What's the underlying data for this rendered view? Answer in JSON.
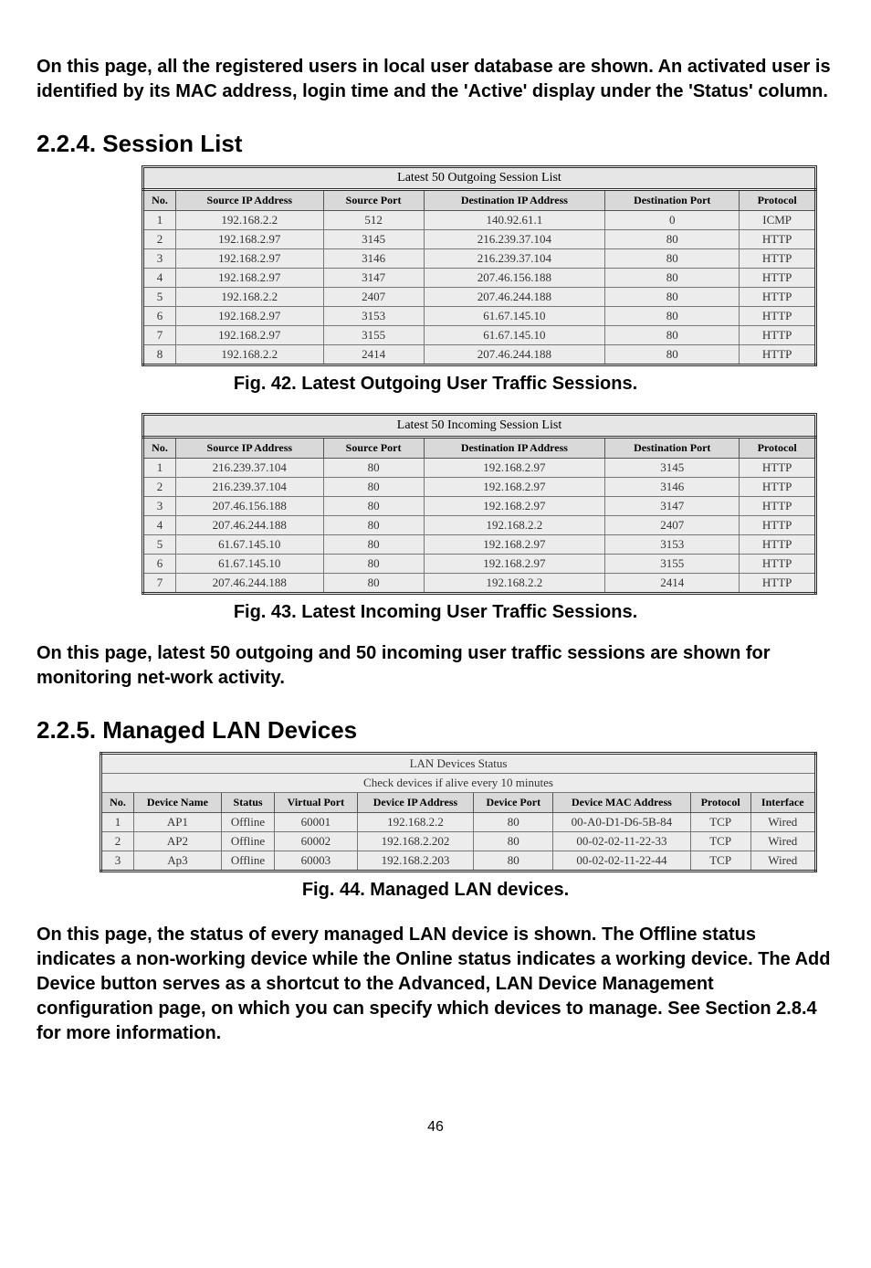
{
  "intro": "On this page, all the registered users in local user database are shown. An activated user is identified by its MAC address, login time and the 'Active' display under the 'Status' column.",
  "section224": "2.2.4. Session List",
  "outgoing": {
    "title": "Latest 50 Outgoing Session List",
    "headers": [
      "No.",
      "Source IP Address",
      "Source Port",
      "Destination IP Address",
      "Destination Port",
      "Protocol"
    ],
    "rows": [
      [
        "1",
        "192.168.2.2",
        "512",
        "140.92.61.1",
        "0",
        "ICMP"
      ],
      [
        "2",
        "192.168.2.97",
        "3145",
        "216.239.37.104",
        "80",
        "HTTP"
      ],
      [
        "3",
        "192.168.2.97",
        "3146",
        "216.239.37.104",
        "80",
        "HTTP"
      ],
      [
        "4",
        "192.168.2.97",
        "3147",
        "207.46.156.188",
        "80",
        "HTTP"
      ],
      [
        "5",
        "192.168.2.2",
        "2407",
        "207.46.244.188",
        "80",
        "HTTP"
      ],
      [
        "6",
        "192.168.2.97",
        "3153",
        "61.67.145.10",
        "80",
        "HTTP"
      ],
      [
        "7",
        "192.168.2.97",
        "3155",
        "61.67.145.10",
        "80",
        "HTTP"
      ],
      [
        "8",
        "192.168.2.2",
        "2414",
        "207.46.244.188",
        "80",
        "HTTP"
      ]
    ],
    "caption": "Fig. 42. Latest Outgoing User Traffic Sessions."
  },
  "incoming": {
    "title": "Latest 50 Incoming Session List",
    "headers": [
      "No.",
      "Source IP Address",
      "Source Port",
      "Destination IP Address",
      "Destination Port",
      "Protocol"
    ],
    "rows": [
      [
        "1",
        "216.239.37.104",
        "80",
        "192.168.2.97",
        "3145",
        "HTTP"
      ],
      [
        "2",
        "216.239.37.104",
        "80",
        "192.168.2.97",
        "3146",
        "HTTP"
      ],
      [
        "3",
        "207.46.156.188",
        "80",
        "192.168.2.97",
        "3147",
        "HTTP"
      ],
      [
        "4",
        "207.46.244.188",
        "80",
        "192.168.2.2",
        "2407",
        "HTTP"
      ],
      [
        "5",
        "61.67.145.10",
        "80",
        "192.168.2.97",
        "3153",
        "HTTP"
      ],
      [
        "6",
        "61.67.145.10",
        "80",
        "192.168.2.97",
        "3155",
        "HTTP"
      ],
      [
        "7",
        "207.46.244.188",
        "80",
        "192.168.2.2",
        "2414",
        "HTTP"
      ]
    ],
    "caption": "Fig. 43. Latest Incoming User Traffic Sessions."
  },
  "para2": "On this page, latest 50 outgoing and 50 incoming user traffic sessions are shown for monitoring net-work activity.",
  "section225": "2.2.5. Managed LAN Devices",
  "lan": {
    "boxTitle": "LAN Devices Status",
    "checkText": "Check devices if alive every 10 minutes",
    "headers": [
      "No.",
      "Device Name",
      "Status",
      "Virtual Port",
      "Device IP Address",
      "Device Port",
      "Device MAC Address",
      "Protocol",
      "Interface"
    ],
    "rows": [
      [
        "1",
        "AP1",
        "Offline",
        "60001",
        "192.168.2.2",
        "80",
        "00-A0-D1-D6-5B-84",
        "TCP",
        "Wired"
      ],
      [
        "2",
        "AP2",
        "Offline",
        "60002",
        "192.168.2.202",
        "80",
        "00-02-02-11-22-33",
        "TCP",
        "Wired"
      ],
      [
        "3",
        "Ap3",
        "Offline",
        "60003",
        "192.168.2.203",
        "80",
        "00-02-02-11-22-44",
        "TCP",
        "Wired"
      ]
    ],
    "caption": "Fig. 44. Managed LAN devices."
  },
  "para3_a": "On this page, the status of every managed LAN device is shown. The Offline status indicates a non-working device while the Online status indicates a working device. The ",
  "para3_bold": "Add Device",
  "para3_b": " button serves as a shortcut to the Advanced, LAN Device Management configuration page, on which you can specify which devices to manage. See Section 2.8.4 for more information.",
  "pagenum": "46"
}
